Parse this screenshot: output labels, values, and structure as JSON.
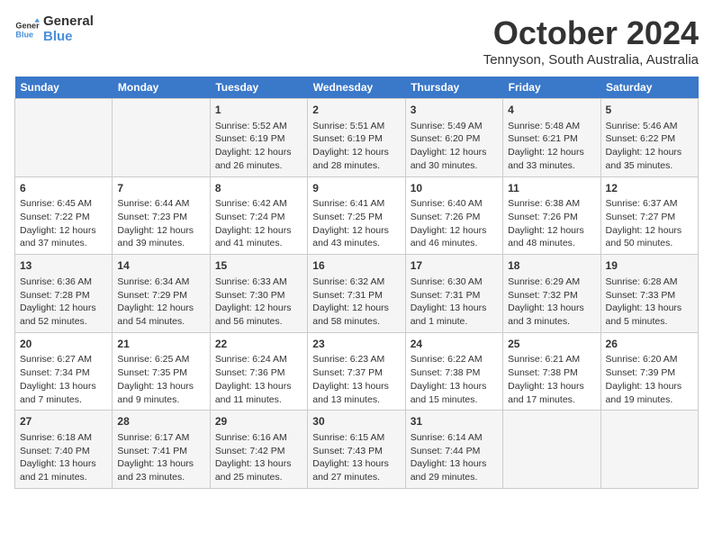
{
  "logo": {
    "line1": "General",
    "line2": "Blue"
  },
  "title": "October 2024",
  "location": "Tennyson, South Australia, Australia",
  "days_header": [
    "Sunday",
    "Monday",
    "Tuesday",
    "Wednesday",
    "Thursday",
    "Friday",
    "Saturday"
  ],
  "weeks": [
    [
      {
        "day": "",
        "content": ""
      },
      {
        "day": "",
        "content": ""
      },
      {
        "day": "1",
        "content": "Sunrise: 5:52 AM\nSunset: 6:19 PM\nDaylight: 12 hours and 26 minutes."
      },
      {
        "day": "2",
        "content": "Sunrise: 5:51 AM\nSunset: 6:19 PM\nDaylight: 12 hours and 28 minutes."
      },
      {
        "day": "3",
        "content": "Sunrise: 5:49 AM\nSunset: 6:20 PM\nDaylight: 12 hours and 30 minutes."
      },
      {
        "day": "4",
        "content": "Sunrise: 5:48 AM\nSunset: 6:21 PM\nDaylight: 12 hours and 33 minutes."
      },
      {
        "day": "5",
        "content": "Sunrise: 5:46 AM\nSunset: 6:22 PM\nDaylight: 12 hours and 35 minutes."
      }
    ],
    [
      {
        "day": "6",
        "content": "Sunrise: 6:45 AM\nSunset: 7:22 PM\nDaylight: 12 hours and 37 minutes."
      },
      {
        "day": "7",
        "content": "Sunrise: 6:44 AM\nSunset: 7:23 PM\nDaylight: 12 hours and 39 minutes."
      },
      {
        "day": "8",
        "content": "Sunrise: 6:42 AM\nSunset: 7:24 PM\nDaylight: 12 hours and 41 minutes."
      },
      {
        "day": "9",
        "content": "Sunrise: 6:41 AM\nSunset: 7:25 PM\nDaylight: 12 hours and 43 minutes."
      },
      {
        "day": "10",
        "content": "Sunrise: 6:40 AM\nSunset: 7:26 PM\nDaylight: 12 hours and 46 minutes."
      },
      {
        "day": "11",
        "content": "Sunrise: 6:38 AM\nSunset: 7:26 PM\nDaylight: 12 hours and 48 minutes."
      },
      {
        "day": "12",
        "content": "Sunrise: 6:37 AM\nSunset: 7:27 PM\nDaylight: 12 hours and 50 minutes."
      }
    ],
    [
      {
        "day": "13",
        "content": "Sunrise: 6:36 AM\nSunset: 7:28 PM\nDaylight: 12 hours and 52 minutes."
      },
      {
        "day": "14",
        "content": "Sunrise: 6:34 AM\nSunset: 7:29 PM\nDaylight: 12 hours and 54 minutes."
      },
      {
        "day": "15",
        "content": "Sunrise: 6:33 AM\nSunset: 7:30 PM\nDaylight: 12 hours and 56 minutes."
      },
      {
        "day": "16",
        "content": "Sunrise: 6:32 AM\nSunset: 7:31 PM\nDaylight: 12 hours and 58 minutes."
      },
      {
        "day": "17",
        "content": "Sunrise: 6:30 AM\nSunset: 7:31 PM\nDaylight: 13 hours and 1 minute."
      },
      {
        "day": "18",
        "content": "Sunrise: 6:29 AM\nSunset: 7:32 PM\nDaylight: 13 hours and 3 minutes."
      },
      {
        "day": "19",
        "content": "Sunrise: 6:28 AM\nSunset: 7:33 PM\nDaylight: 13 hours and 5 minutes."
      }
    ],
    [
      {
        "day": "20",
        "content": "Sunrise: 6:27 AM\nSunset: 7:34 PM\nDaylight: 13 hours and 7 minutes."
      },
      {
        "day": "21",
        "content": "Sunrise: 6:25 AM\nSunset: 7:35 PM\nDaylight: 13 hours and 9 minutes."
      },
      {
        "day": "22",
        "content": "Sunrise: 6:24 AM\nSunset: 7:36 PM\nDaylight: 13 hours and 11 minutes."
      },
      {
        "day": "23",
        "content": "Sunrise: 6:23 AM\nSunset: 7:37 PM\nDaylight: 13 hours and 13 minutes."
      },
      {
        "day": "24",
        "content": "Sunrise: 6:22 AM\nSunset: 7:38 PM\nDaylight: 13 hours and 15 minutes."
      },
      {
        "day": "25",
        "content": "Sunrise: 6:21 AM\nSunset: 7:38 PM\nDaylight: 13 hours and 17 minutes."
      },
      {
        "day": "26",
        "content": "Sunrise: 6:20 AM\nSunset: 7:39 PM\nDaylight: 13 hours and 19 minutes."
      }
    ],
    [
      {
        "day": "27",
        "content": "Sunrise: 6:18 AM\nSunset: 7:40 PM\nDaylight: 13 hours and 21 minutes."
      },
      {
        "day": "28",
        "content": "Sunrise: 6:17 AM\nSunset: 7:41 PM\nDaylight: 13 hours and 23 minutes."
      },
      {
        "day": "29",
        "content": "Sunrise: 6:16 AM\nSunset: 7:42 PM\nDaylight: 13 hours and 25 minutes."
      },
      {
        "day": "30",
        "content": "Sunrise: 6:15 AM\nSunset: 7:43 PM\nDaylight: 13 hours and 27 minutes."
      },
      {
        "day": "31",
        "content": "Sunrise: 6:14 AM\nSunset: 7:44 PM\nDaylight: 13 hours and 29 minutes."
      },
      {
        "day": "",
        "content": ""
      },
      {
        "day": "",
        "content": ""
      }
    ]
  ]
}
